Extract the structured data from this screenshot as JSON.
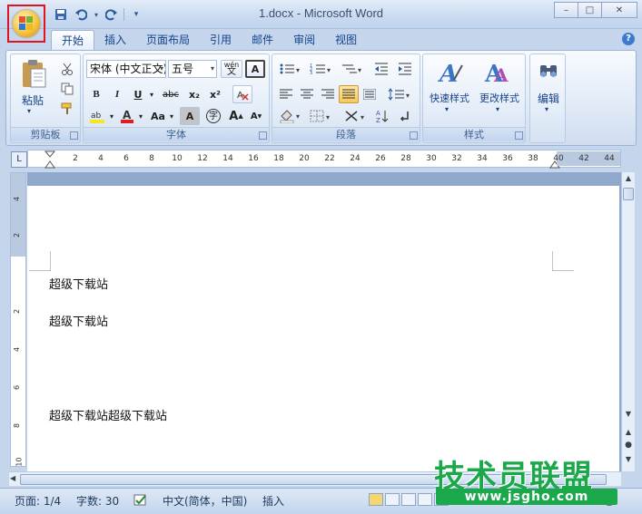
{
  "window": {
    "title": "1.docx - Microsoft Word",
    "minimize": "–",
    "maximize": "□",
    "close": "✕"
  },
  "quick_access": {
    "save_icon": "save-icon",
    "undo_icon": "undo-icon",
    "redo_icon": "redo-icon",
    "customize_icon": "customize-icon"
  },
  "tabs": [
    {
      "label": "开始",
      "active": true
    },
    {
      "label": "插入"
    },
    {
      "label": "页面布局"
    },
    {
      "label": "引用"
    },
    {
      "label": "邮件"
    },
    {
      "label": "审阅"
    },
    {
      "label": "视图"
    }
  ],
  "ribbon": {
    "clipboard": {
      "label": "剪贴板",
      "paste": "粘贴"
    },
    "font": {
      "label": "字体",
      "font_name": "宋体 (中文正文)",
      "font_size": "五号",
      "bold": "B",
      "italic": "I",
      "underline": "U",
      "strike": "abc",
      "subscript": "x₂",
      "superscript": "x²",
      "case": "Aa",
      "grow": "A",
      "shrink": "A",
      "char_border": "A",
      "phonetic": "wén",
      "enclose": "字"
    },
    "paragraph": {
      "label": "段落"
    },
    "styles": {
      "label": "样式",
      "quick_styles": "快速样式",
      "change_styles": "更改样式"
    },
    "editing": {
      "label": "编辑"
    }
  },
  "ruler": {
    "marks": [
      "2",
      "4",
      "6",
      "8",
      "10",
      "12",
      "14",
      "16",
      "18",
      "20",
      "22",
      "24",
      "26",
      "28",
      "30",
      "32",
      "34",
      "36",
      "38",
      "40",
      "42",
      "44"
    ],
    "vertical_marks": [
      "4",
      "2",
      "2",
      "4",
      "6",
      "8",
      "10"
    ]
  },
  "document": {
    "lines": [
      "超级下载站",
      "超级下载站",
      "超级下载站超级下载站"
    ]
  },
  "statusbar": {
    "page": "页面: 1/4",
    "words": "字数: 30",
    "language": "中文(简体，中国)",
    "mode": "插入"
  },
  "watermark": {
    "title": "技术员联盟",
    "url": "www.jsgho.com"
  },
  "colors": {
    "highlight": "#f8e71c",
    "font_color": "#e02020",
    "office_button_border": "#e0141e",
    "watermark": "#1aa84a"
  }
}
